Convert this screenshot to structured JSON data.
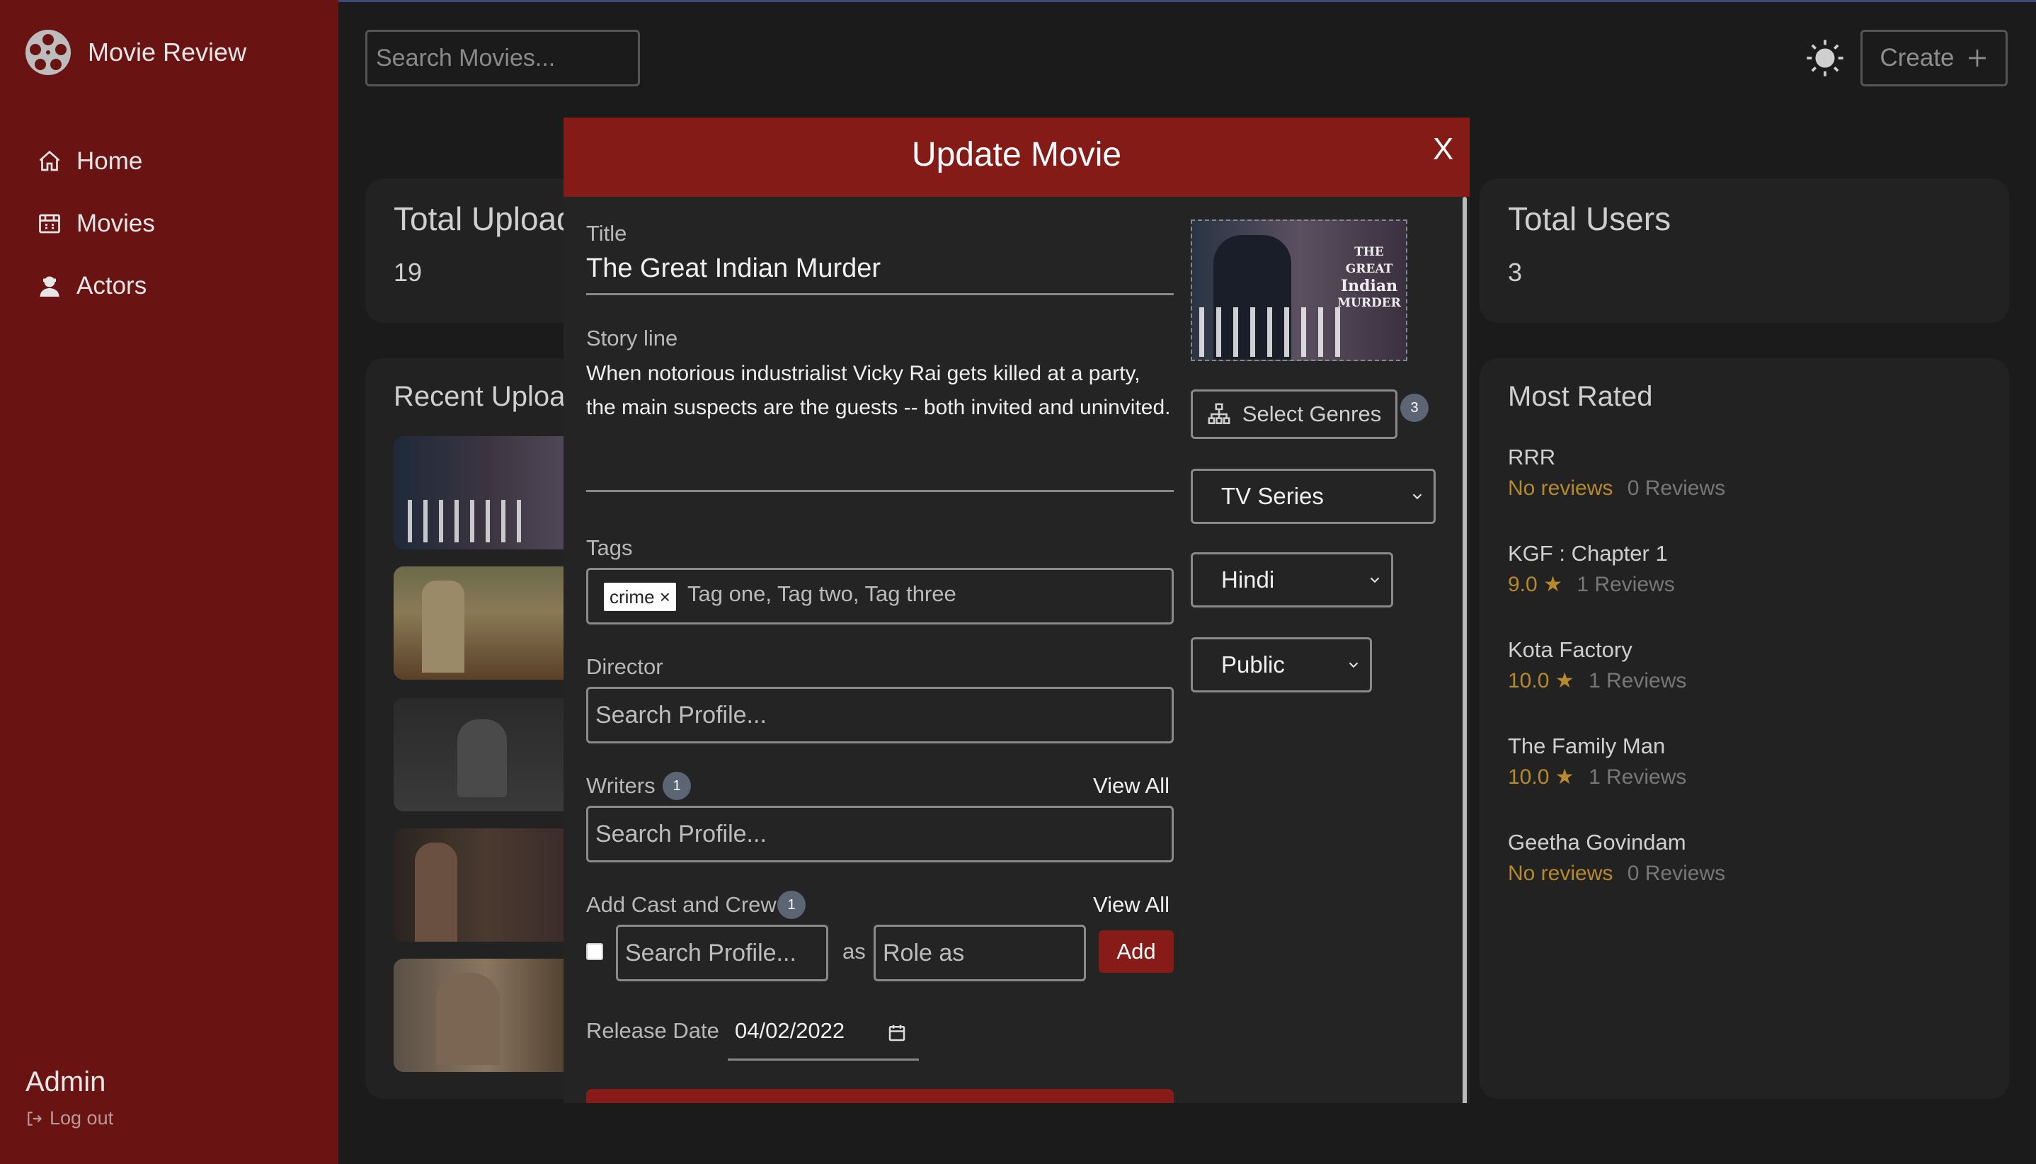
{
  "app": {
    "name": "Movie Review"
  },
  "sidebar": {
    "items": [
      {
        "label": "Home",
        "icon": "home-icon"
      },
      {
        "label": "Movies",
        "icon": "film-icon"
      },
      {
        "label": "Actors",
        "icon": "actor-icon"
      }
    ],
    "user": "Admin",
    "logout": "Log out"
  },
  "header": {
    "search_placeholder": "Search Movies...",
    "create_label": "Create"
  },
  "stats": {
    "uploads_title": "Total Uploads",
    "uploads_value": "19",
    "users_title": "Total Users",
    "users_value": "3"
  },
  "recent": {
    "title": "Recent Uploads"
  },
  "most_rated": {
    "title": "Most Rated",
    "items": [
      {
        "name": "RRR",
        "rating": "No reviews",
        "reviews": "0 Reviews",
        "star": false
      },
      {
        "name": "KGF : Chapter 1",
        "rating": "9.0",
        "reviews": "1 Reviews",
        "star": true
      },
      {
        "name": "Kota Factory",
        "rating": "10.0",
        "reviews": "1 Reviews",
        "star": true
      },
      {
        "name": "The Family Man",
        "rating": "10.0",
        "reviews": "1 Reviews",
        "star": true
      },
      {
        "name": "Geetha Govindam",
        "rating": "No reviews",
        "reviews": "0 Reviews",
        "star": false
      }
    ]
  },
  "modal": {
    "title": "Update Movie",
    "close": "X",
    "title_label": "Title",
    "title_value": "The Great Indian Murder",
    "story_label": "Story line",
    "story_value": "When notorious industrialist Vicky Rai gets killed at a party, the main suspects are the guests -- both invited and uninvited.",
    "tags_label": "Tags",
    "tag_chip": "crime",
    "tags_placeholder": "Tag one, Tag two, Tag three",
    "director_label": "Director",
    "director_placeholder": "Search Profile...",
    "writers_label": "Writers",
    "writers_count": "1",
    "writers_view_all": "View All",
    "writers_placeholder": "Search Profile...",
    "cast_label": "Add Cast and Crew",
    "cast_count": "1",
    "cast_view_all": "View All",
    "cast_profile_placeholder": "Search Profile...",
    "cast_as": "as",
    "cast_role_placeholder": "Role as",
    "cast_add": "Add",
    "release_label": "Release Date",
    "release_value": "04/02/2022",
    "genres_button": "Select Genres",
    "genres_count": "3",
    "type_select": "TV Series",
    "language_select": "Hindi",
    "status_select": "Public",
    "poster_text_1": "THE GREAT",
    "poster_text_2": "Indian",
    "poster_text_3": "MURDER"
  },
  "colors": {
    "sidebar": "#691312",
    "accent": "#841b17",
    "background": "#1b1b1b",
    "card": "#222222",
    "gold": "#b58a2c"
  }
}
